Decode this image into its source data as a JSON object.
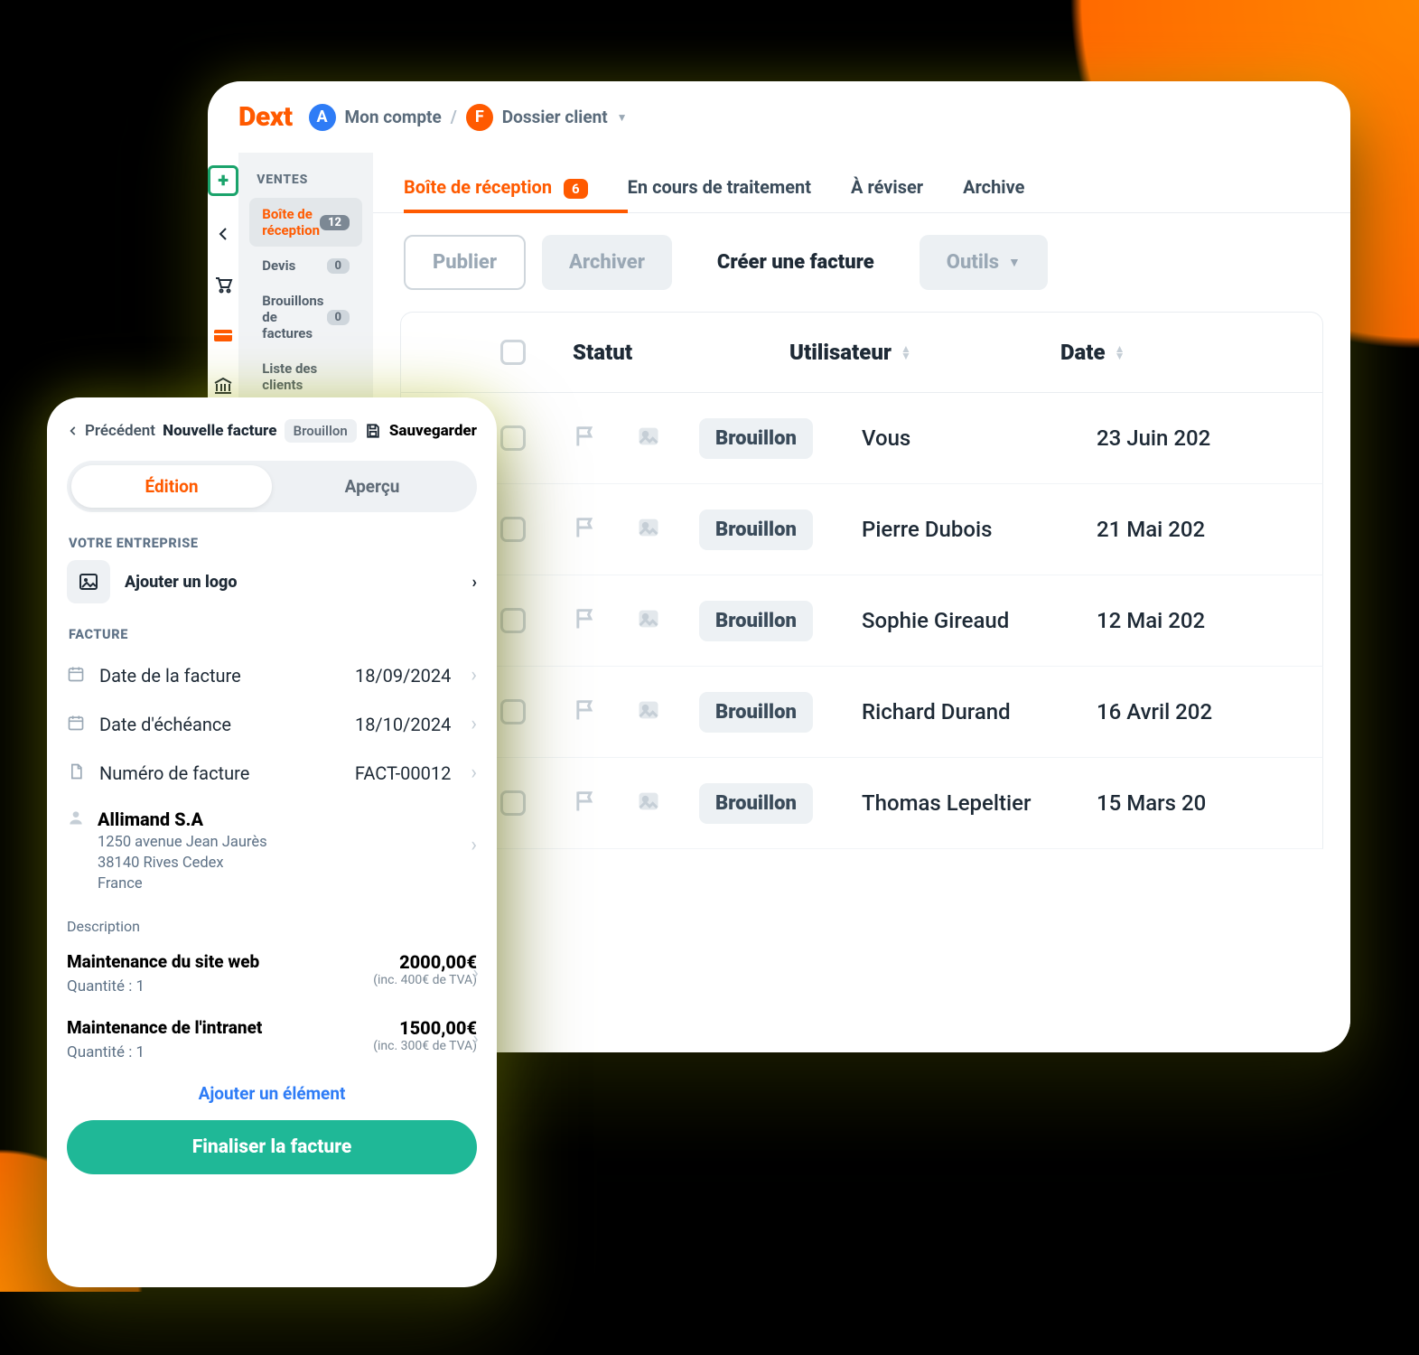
{
  "logo": "Dext",
  "crumbs": {
    "account_label": "Mon compte",
    "client_label": "Dossier client"
  },
  "sidebar": {
    "heading": "VENTES",
    "items": [
      {
        "label": "Boîte de réception",
        "count": "12"
      },
      {
        "label": "Devis",
        "count": "0"
      },
      {
        "label": "Brouillons de factures",
        "count": "0"
      },
      {
        "label": "Liste des clients"
      }
    ]
  },
  "tabs": [
    {
      "label": "Boîte de réception",
      "count": "6"
    },
    {
      "label": "En cours de traitement"
    },
    {
      "label": "À réviser"
    },
    {
      "label": "Archive"
    }
  ],
  "actions": {
    "publish": "Publier",
    "archive": "Archiver",
    "create": "Créer une facture",
    "tools": "Outils"
  },
  "table": {
    "headers": {
      "status": "Statut",
      "user": "Utilisateur",
      "date": "Date"
    },
    "rows": [
      {
        "dot": true,
        "status": "Brouillon",
        "user": "Vous",
        "date": "23 Juin 202"
      },
      {
        "dot": false,
        "status": "Brouillon",
        "user": "Pierre Dubois",
        "date": "21 Mai 202"
      },
      {
        "dot": false,
        "status": "Brouillon",
        "user": "Sophie Gireaud",
        "date": "12 Mai 202"
      },
      {
        "dot": true,
        "status": "Brouillon",
        "user": "Richard Durand",
        "date": "16 Avril 202"
      },
      {
        "dot": true,
        "status": "Brouillon",
        "user": "Thomas Lepeltier",
        "date": "15 Mars 20"
      }
    ]
  },
  "mobile": {
    "back": "Précédent",
    "title": "Nouvelle facture",
    "status_chip": "Brouillon",
    "save": "Sauvegarder",
    "seg": {
      "edit": "Édition",
      "preview": "Aperçu"
    },
    "company_heading": "VOTRE ENTREPRISE",
    "add_logo": "Ajouter un logo",
    "invoice_heading": "FACTURE",
    "fields": {
      "date_label": "Date de la facture",
      "date_value": "18/09/2024",
      "due_label": "Date d'échéance",
      "due_value": "18/10/2024",
      "num_label": "Numéro de facture",
      "num_value": "FACT-00012"
    },
    "client": {
      "name": "Allimand S.A",
      "line1": "1250 avenue Jean Jaurès",
      "line2": "38140 Rives Cedex",
      "line3": "France"
    },
    "description_label": "Description",
    "items": [
      {
        "title": "Maintenance du site web",
        "qty": "Quantité : 1",
        "amount": "2000,00€",
        "sub": "(inc. 400€ de TVA)"
      },
      {
        "title": "Maintenance de l'intranet",
        "qty": "Quantité : 1",
        "amount": "1500,00€",
        "sub": "(inc. 300€ de TVA)"
      }
    ],
    "add_item": "Ajouter un élément",
    "finalize": "Finaliser la facture"
  }
}
